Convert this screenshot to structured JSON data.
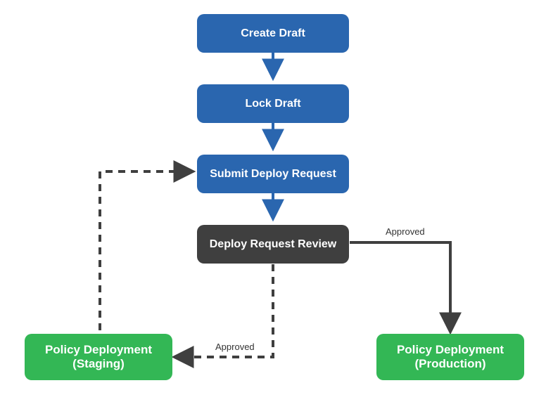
{
  "nodes": {
    "create_draft": {
      "label": "Create Draft"
    },
    "lock_draft": {
      "label": "Lock Draft"
    },
    "submit_deploy": {
      "label": "Submit Deploy Request"
    },
    "review": {
      "label": "Deploy Request Review"
    },
    "staging": {
      "label_l1": "Policy Deployment",
      "label_l2": "(Staging)"
    },
    "production": {
      "label_l1": "Policy Deployment",
      "label_l2": "(Production)"
    }
  },
  "edges": {
    "review_to_staging": {
      "label": "Approved"
    },
    "review_to_production": {
      "label": "Approved"
    }
  },
  "colors": {
    "blue": "#2a66af",
    "dark": "#3f3f3f",
    "green": "#33b755"
  }
}
